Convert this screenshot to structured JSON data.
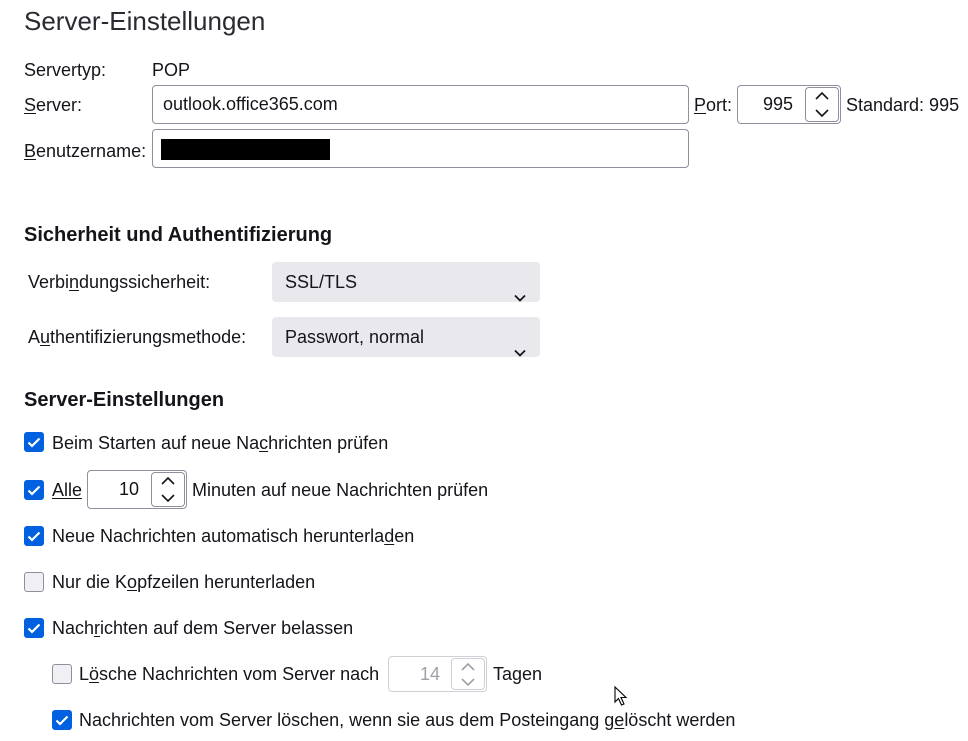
{
  "page": {
    "title": "Server-Einstellungen"
  },
  "server": {
    "type_label": "Servertyp:",
    "type_value": "POP",
    "server_label_pre": "",
    "server_label_ul": "S",
    "server_label_post": "erver:",
    "server_value": "outlook.office365.com",
    "port_label_ul": "P",
    "port_label_post": "ort:",
    "port_value": "995",
    "standard_text": "Standard: 995",
    "user_label_ul": "B",
    "user_label_post": "enutzername:"
  },
  "security": {
    "heading": "Sicherheit und Authentifizierung",
    "conn_label_pre": "Verbi",
    "conn_label_ul": "n",
    "conn_label_post": "dungssicherheit:",
    "conn_value": "SSL/TLS",
    "auth_label_pre": "A",
    "auth_label_ul": "u",
    "auth_label_post": "thentifizierungsmethode:",
    "auth_value": "Passwort, normal"
  },
  "settings": {
    "heading": "Server-Einstellungen",
    "check_start": {
      "pre": "Beim Starten auf neue Na",
      "ul": "c",
      "post": "hrichten prüfen",
      "checked": true
    },
    "check_every": {
      "ul": "Alle",
      "value": "10",
      "post": "Minuten auf neue Nachrichten prüfen",
      "checked": true
    },
    "auto_download": {
      "pre": "Neue Nachrichten automatisch herunterla",
      "ul": "d",
      "post": "en",
      "checked": true
    },
    "headers_only": {
      "pre": "Nur die K",
      "ul": "o",
      "post": "pfzeilen herunterladen",
      "checked": false
    },
    "leave_on_server": {
      "pre": "Nach",
      "ul": "r",
      "post": "ichten auf dem Server belassen",
      "checked": true
    },
    "delete_after": {
      "pre": "L",
      "ul": "ö",
      "post": "sche Nachrichten vom Server nach",
      "value": "14",
      "suffix": "Tagen",
      "checked": false
    },
    "delete_when_deleted": {
      "pre": "Nachrichten vom Server löschen, wenn sie aus dem Posteingang g",
      "ul": "e",
      "post": "löscht werden",
      "checked": true
    }
  },
  "colors": {
    "accent": "#0061e0",
    "select_bg": "#e9e9ed",
    "border": "#8f8f9d"
  },
  "icons": {
    "check": "check-icon",
    "chevron": "chevron-down-icon",
    "spin_up": "chevron-up-icon",
    "spin_down": "chevron-down-icon",
    "cursor": "mouse-pointer-icon"
  }
}
